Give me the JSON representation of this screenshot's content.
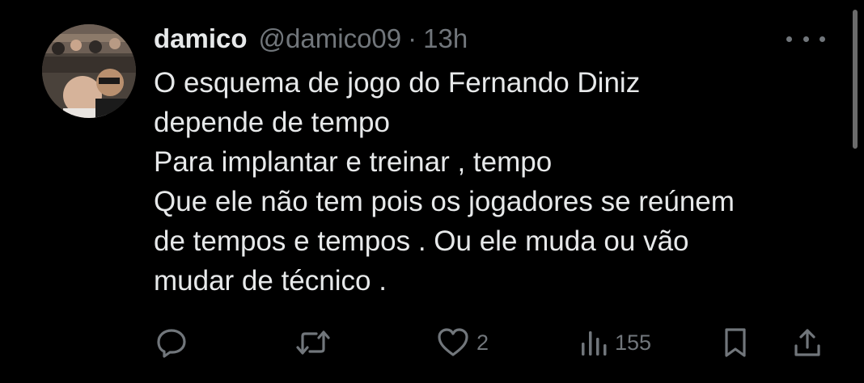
{
  "tweet": {
    "author_name": "damico",
    "handle": "@damico09",
    "separator": "·",
    "time": "13h",
    "text_lines": [
      "O esquema de jogo do Fernando Diniz",
      "depende de tempo",
      "Para implantar e treinar , tempo",
      "Que ele não tem pois os jogadores se reúnem",
      "de tempos e tempos . Ou ele muda ou vão",
      "mudar de técnico ."
    ]
  },
  "actions": {
    "reply": {
      "icon": "reply-icon"
    },
    "retweet": {
      "icon": "retweet-icon"
    },
    "like": {
      "icon": "heart-icon",
      "count": "2"
    },
    "views": {
      "icon": "views-icon",
      "count": "155"
    },
    "bookmark": {
      "icon": "bookmark-icon"
    },
    "share": {
      "icon": "share-icon"
    }
  },
  "theme": {
    "background": "#000000",
    "text": "#e7e9ea",
    "muted": "#71767b"
  }
}
